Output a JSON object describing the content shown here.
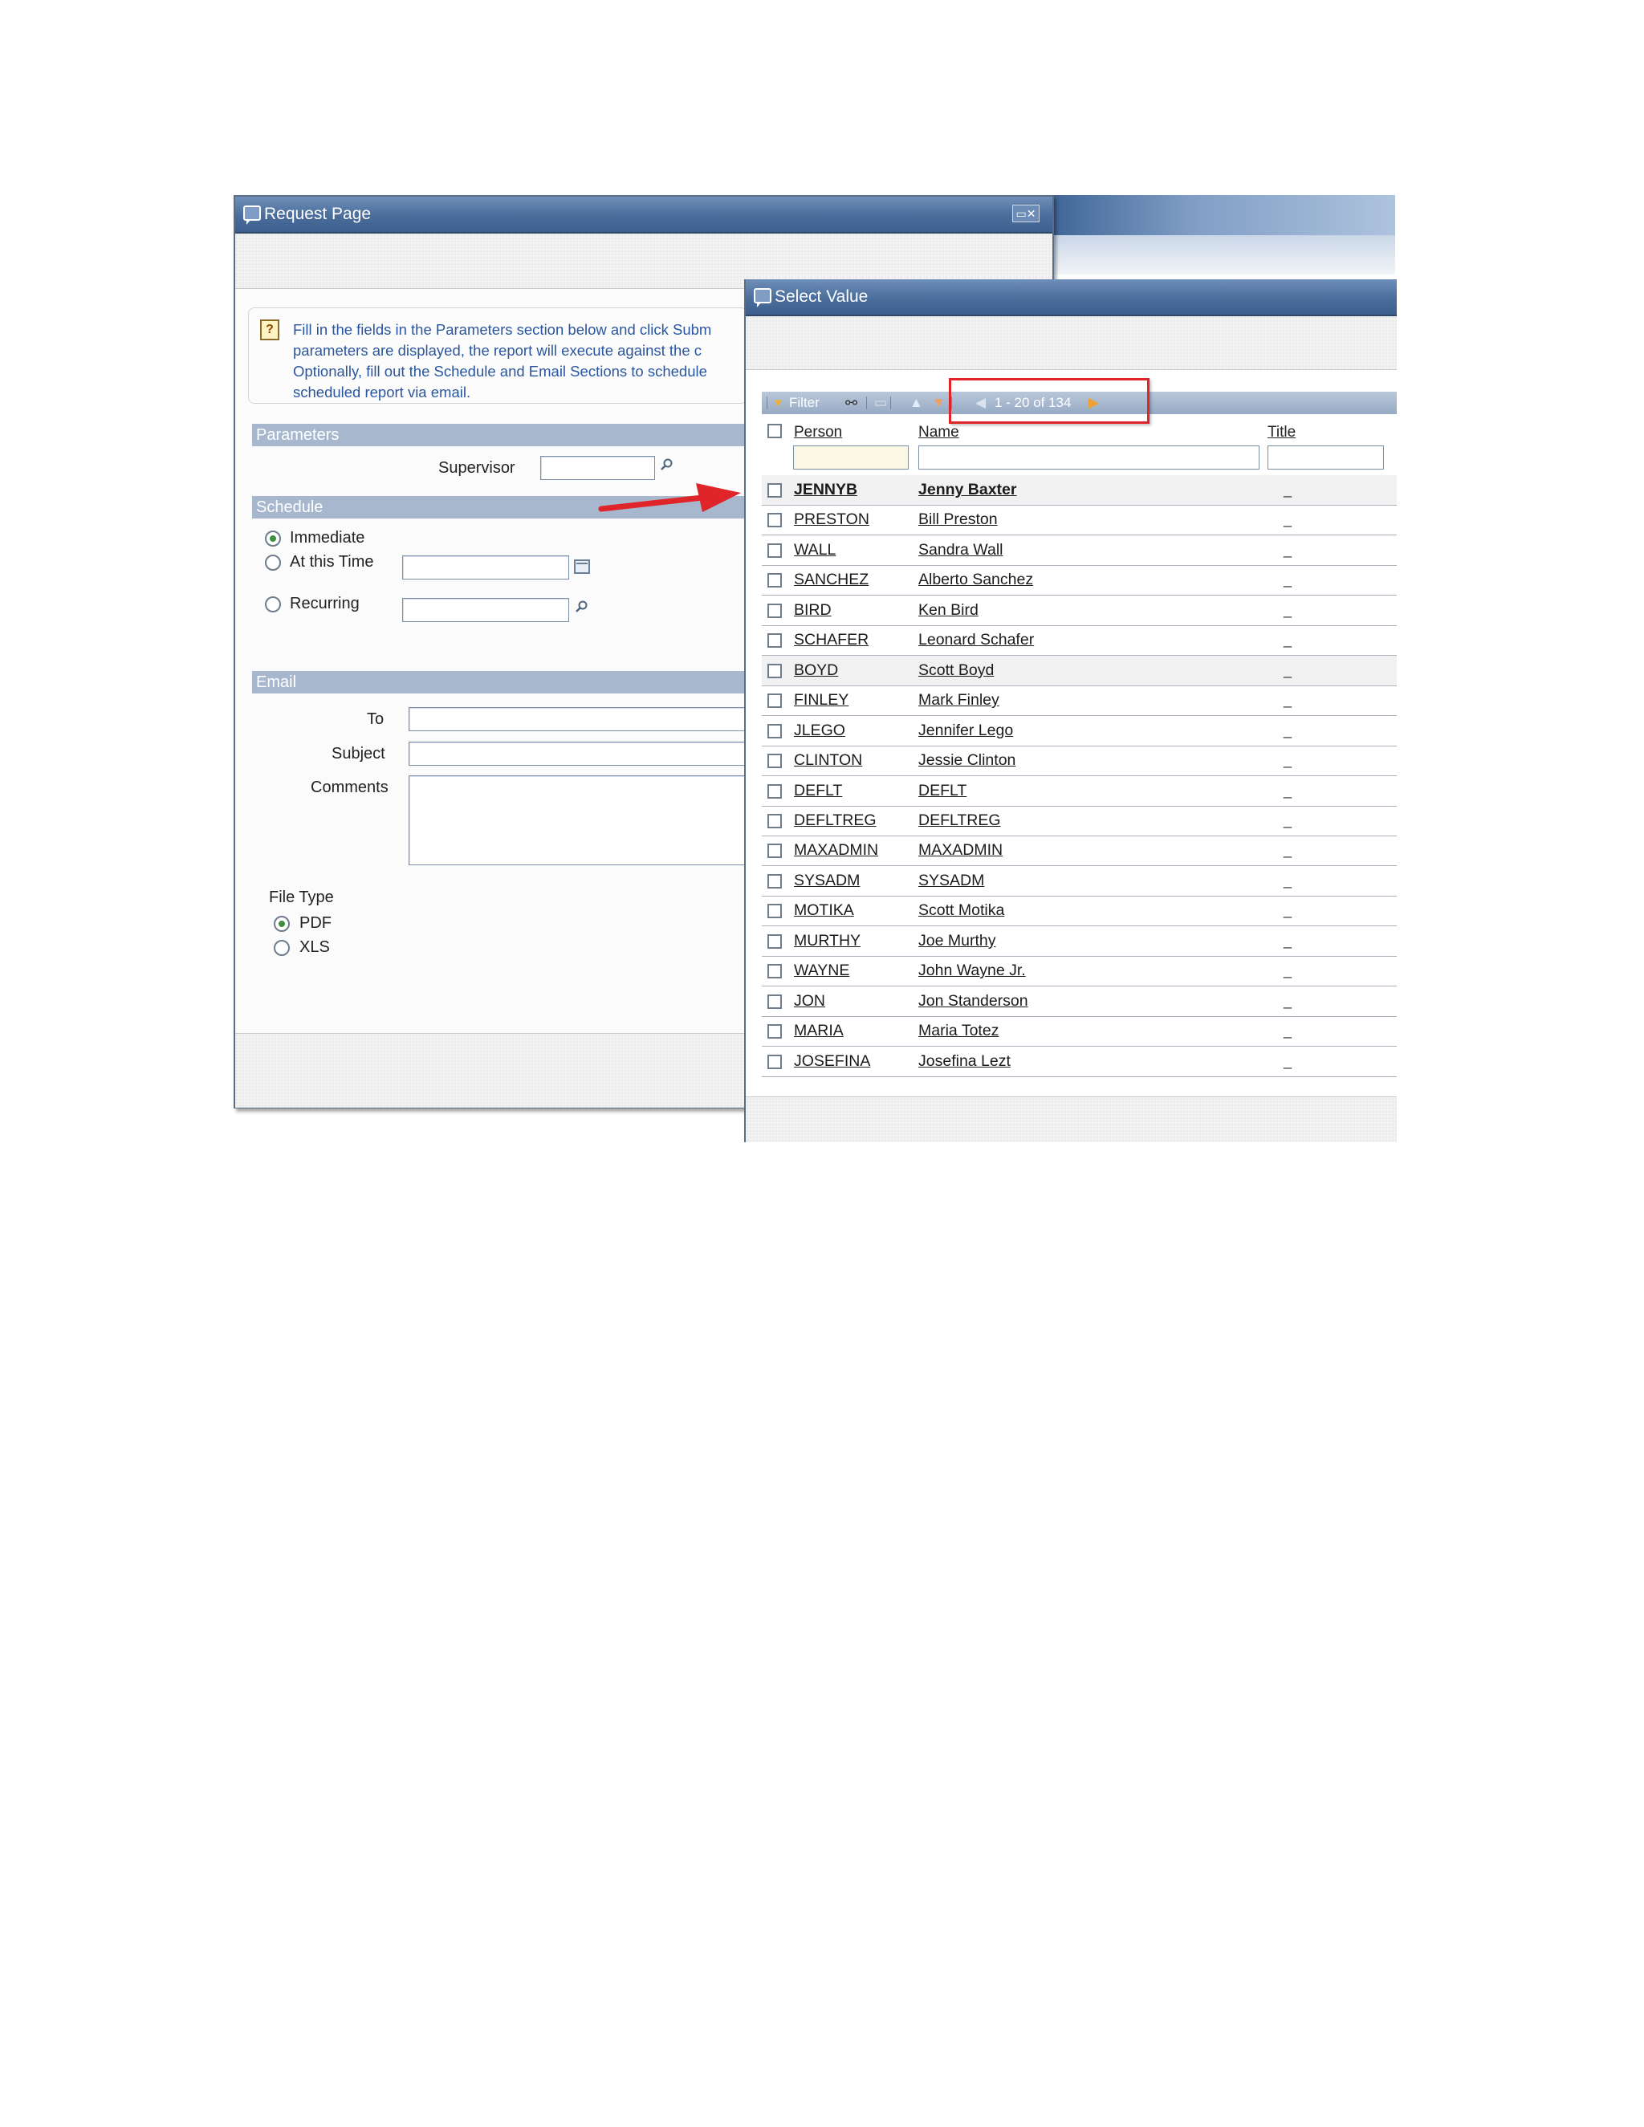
{
  "request_window": {
    "title": "Request Page",
    "info_lines": [
      "Fill in the fields in the Parameters section below and click Subm",
      "parameters are displayed, the report will execute against the c",
      "Optionally, fill out the Schedule and Email Sections to schedule",
      "scheduled report via email."
    ],
    "parameters": {
      "heading": "Parameters",
      "supervisor_label": "Supervisor"
    },
    "schedule": {
      "heading": "Schedule",
      "options": [
        "Immediate",
        "At this Time",
        "Recurring"
      ],
      "selected": "Immediate"
    },
    "email": {
      "heading": "Email",
      "to_label": "To",
      "subject_label": "Subject",
      "comments_label": "Comments"
    },
    "file_type": {
      "label": "File Type",
      "options": [
        "PDF",
        "XLS"
      ],
      "selected": "PDF"
    }
  },
  "select_window": {
    "title": "Select Value",
    "toolbar": {
      "filter_label": "Filter",
      "pagination": "1 - 20 of 134"
    },
    "columns": [
      "Person",
      "Name",
      "Title"
    ],
    "rows": [
      {
        "person": "JENNYB",
        "name": "Jenny Baxter",
        "highlighted": true
      },
      {
        "person": "PRESTON",
        "name": "Bill Preston"
      },
      {
        "person": "WALL",
        "name": "Sandra Wall"
      },
      {
        "person": "SANCHEZ",
        "name": "Alberto Sanchez"
      },
      {
        "person": "BIRD",
        "name": "Ken Bird"
      },
      {
        "person": "SCHAFER",
        "name": "Leonard Schafer"
      },
      {
        "person": "BOYD",
        "name": "Scott Boyd",
        "shaded": true
      },
      {
        "person": "FINLEY",
        "name": "Mark Finley"
      },
      {
        "person": "JLEGO",
        "name": "Jennifer Lego"
      },
      {
        "person": "CLINTON",
        "name": "Jessie Clinton"
      },
      {
        "person": "DEFLT",
        "name": "DEFLT"
      },
      {
        "person": "DEFLTREG",
        "name": "DEFLTREG"
      },
      {
        "person": "MAXADMIN",
        "name": "MAXADMIN"
      },
      {
        "person": "SYSADM",
        "name": "SYSADM"
      },
      {
        "person": "MOTIKA",
        "name": "Scott Motika"
      },
      {
        "person": "MURTHY",
        "name": "Joe Murthy"
      },
      {
        "person": "WAYNE",
        "name": "John Wayne Jr."
      },
      {
        "person": "JON",
        "name": "Jon Standerson"
      },
      {
        "person": "MARIA",
        "name": "Maria Totez"
      },
      {
        "person": "JOSEFINA",
        "name": "Josefina Lezt"
      }
    ]
  },
  "colors": {
    "title_bar": "#4a6d9b",
    "section_bar": "#a7b7cd",
    "info_text": "#2a56a0",
    "annotation_red": "#e0252a"
  }
}
